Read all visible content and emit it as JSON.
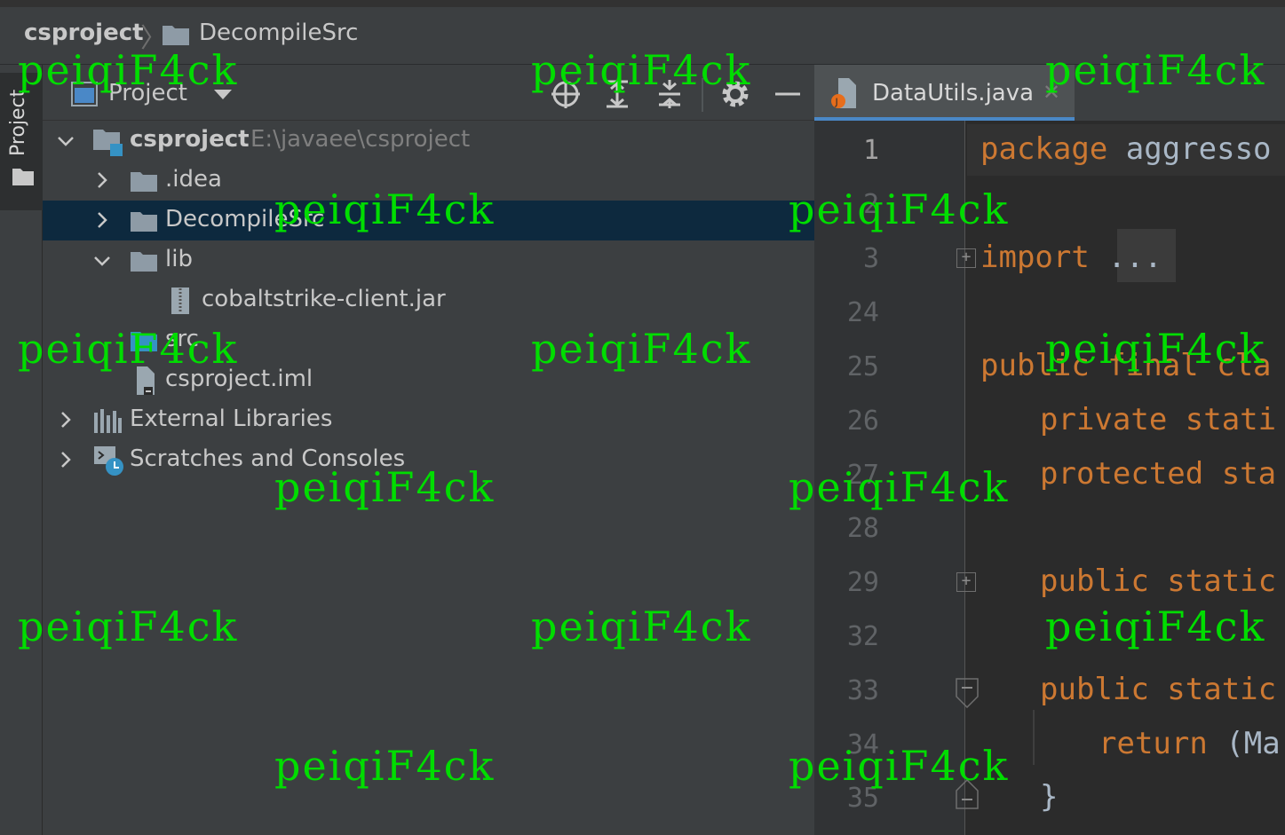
{
  "breadcrumb": {
    "root": "csproject",
    "child": "DecompileSrc"
  },
  "sidebar": {
    "tab_label": "Project"
  },
  "project_panel": {
    "title": "Project",
    "tree": [
      {
        "label": "csproject",
        "path": "E:\\javaee\\csproject",
        "expanded": true,
        "icon": "project-module-icon"
      },
      {
        "label": ".idea",
        "expanded": false,
        "icon": "folder-icon"
      },
      {
        "label": "DecompileSrc",
        "expanded": false,
        "icon": "folder-icon",
        "selected": true
      },
      {
        "label": "lib",
        "expanded": true,
        "icon": "folder-icon"
      },
      {
        "label": "cobaltstrike-client.jar",
        "icon": "jar-archive-icon"
      },
      {
        "label": "src",
        "icon": "source-folder-icon"
      },
      {
        "label": "csproject.iml",
        "icon": "iml-file-icon"
      },
      {
        "label": "External Libraries",
        "expanded": false,
        "icon": "libraries-icon"
      },
      {
        "label": "Scratches and Consoles",
        "expanded": false,
        "icon": "scratches-icon"
      }
    ]
  },
  "editor": {
    "tab": {
      "filename": "DataUtils.java"
    },
    "line_numbers": [
      "1",
      "2",
      "3",
      "24",
      "25",
      "26",
      "27",
      "28",
      "29",
      "32",
      "33",
      "34",
      "35"
    ],
    "code": {
      "l1_kw": "package",
      "l1_rest": " aggresso",
      "l3_kw": "import",
      "l3_fold": "...",
      "l25": "public final cla",
      "l26": "private stati",
      "l27": "protected sta",
      "l29": "public static",
      "l33": "public static",
      "l34_kw": "return",
      "l34_rest": " (Ma",
      "l35": "}"
    }
  },
  "watermark": "peiqiF4ck",
  "colors": {
    "keyword": "#cc7832",
    "selection": "#0d293e",
    "watermark": "#00dd00"
  }
}
